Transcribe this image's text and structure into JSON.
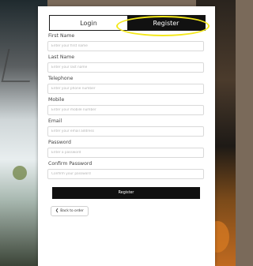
{
  "tabs": {
    "login": "Login",
    "register": "Register",
    "active": "register"
  },
  "form": {
    "fields": [
      {
        "label": "First Name",
        "placeholder": "Enter your first name"
      },
      {
        "label": "Last Name",
        "placeholder": "Enter your last name"
      },
      {
        "label": "Telephone",
        "placeholder": "Enter your phone number"
      },
      {
        "label": "Mobile",
        "placeholder": "Enter your mobile number"
      },
      {
        "label": "Email",
        "placeholder": "Enter your email address"
      },
      {
        "label": "Password",
        "placeholder": "Enter a password"
      },
      {
        "label": "Confirm Password",
        "placeholder": "Confirm your password"
      }
    ],
    "submit_label": "Register",
    "back_label": "Back to order",
    "back_icon": "chevron-left-icon"
  },
  "colors": {
    "accent": "#111111",
    "highlight": "#f4e81a"
  }
}
